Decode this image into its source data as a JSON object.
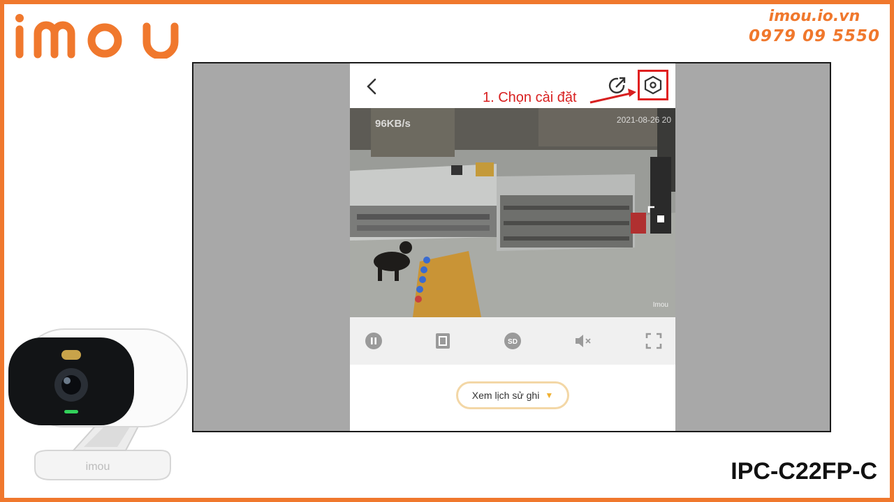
{
  "brand": {
    "logo_text": "imou",
    "url": "imou.io.vn",
    "phone": "0979 09 5550",
    "model": "IPC-C22FP-C",
    "accent": "#f0782d"
  },
  "app": {
    "annotation": "1. Chọn cài đặt",
    "annotation_color": "#d82020",
    "video": {
      "bitrate": "96KB/s",
      "timestamp": "2021-08-26 20",
      "watermark": "Imou"
    },
    "controls": [
      {
        "name": "pause-icon"
      },
      {
        "name": "screenshot-icon"
      },
      {
        "name": "sd-quality-icon",
        "label": "SD"
      },
      {
        "name": "mute-icon"
      },
      {
        "name": "fullscreen-icon"
      }
    ],
    "history_button": "Xem lịch sử ghi"
  }
}
